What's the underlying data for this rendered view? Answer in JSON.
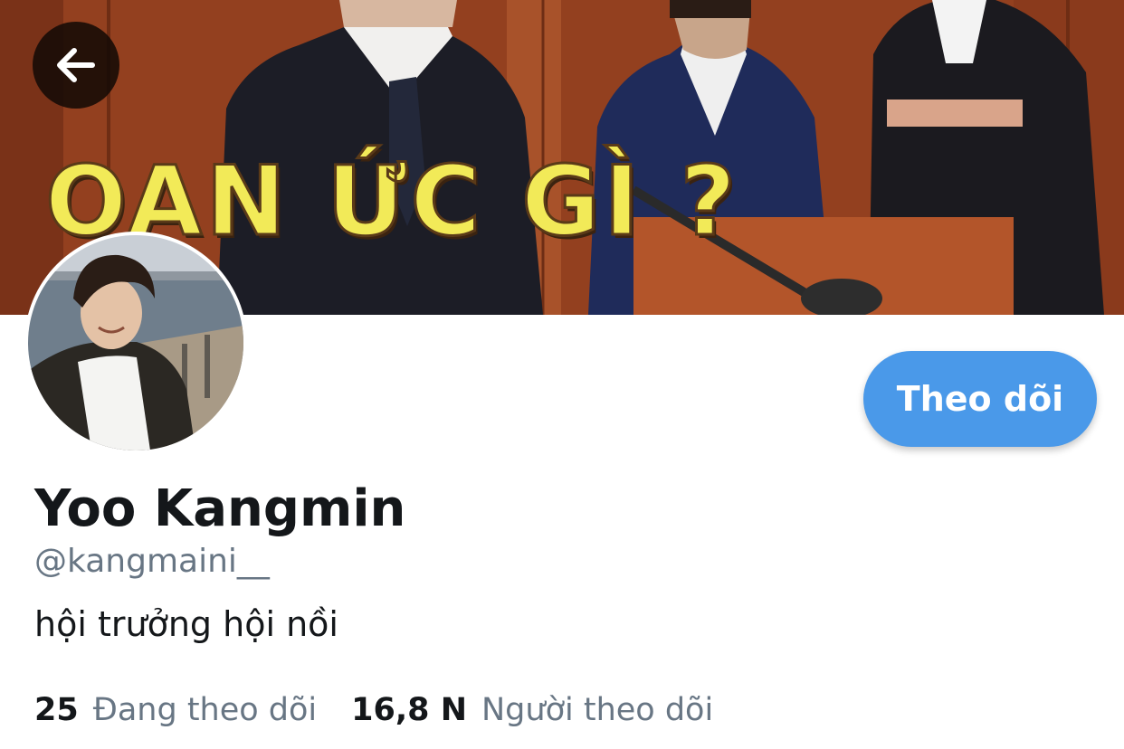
{
  "banner": {
    "caption": "OAN ỨC GÌ ?"
  },
  "header": {
    "back_icon": "arrow-left-icon"
  },
  "profile": {
    "display_name": "Yoo Kangmin",
    "handle": "@kangmaini__",
    "bio": "hội trưởng hội nồi",
    "follow_label": "Theo dõi"
  },
  "stats": {
    "following_count": "25",
    "following_label": "Đang theo dõi",
    "followers_count": "16,8 N",
    "followers_label": "Người theo dõi"
  },
  "colors": {
    "accent": "#4a99e9",
    "primary_text": "#14171a",
    "secondary_text": "#687684",
    "caption_yellow": "#f2ea58"
  }
}
